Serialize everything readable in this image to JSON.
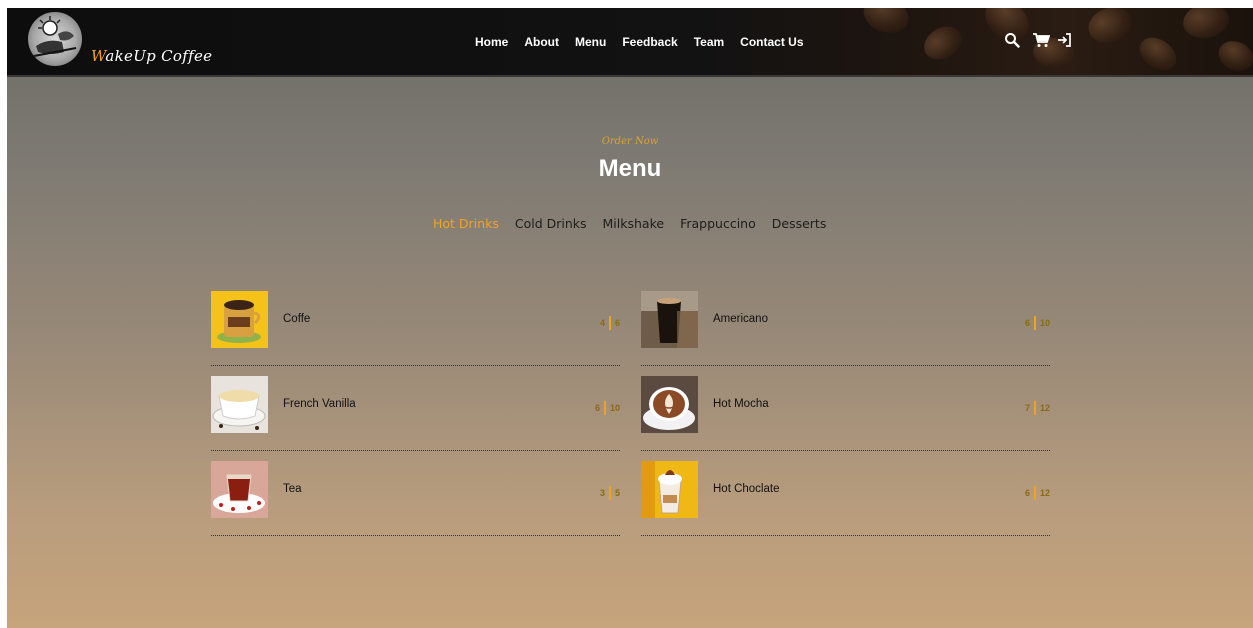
{
  "brand": {
    "first_letter": "W",
    "rest": "akeUp Coffee"
  },
  "nav": {
    "links": [
      "Home",
      "About",
      "Menu",
      "Feedback",
      "Team",
      "Contact Us"
    ],
    "icons": [
      "search-icon",
      "cart-icon",
      "login-icon"
    ]
  },
  "heading": {
    "eyebrow": "Order Now",
    "title": "Menu"
  },
  "tabs": [
    {
      "label": "Hot Drinks",
      "active": true
    },
    {
      "label": "Cold Drinks",
      "active": false
    },
    {
      "label": "Milkshake",
      "active": false
    },
    {
      "label": "Frappuccino",
      "active": false
    },
    {
      "label": "Desserts",
      "active": false
    }
  ],
  "items": [
    {
      "name": "Coffe",
      "price_small": "4",
      "price_large": "6"
    },
    {
      "name": "Americano",
      "price_small": "6",
      "price_large": "10"
    },
    {
      "name": "French Vanilla",
      "price_small": "6",
      "price_large": "10"
    },
    {
      "name": "Hot Mocha",
      "price_small": "7",
      "price_large": "12"
    },
    {
      "name": "Tea",
      "price_small": "3",
      "price_large": "5"
    },
    {
      "name": "Hot Choclate",
      "price_small": "6",
      "price_large": "12"
    }
  ],
  "colors": {
    "accent": "#f0a321",
    "nav_bg": "#111111"
  }
}
